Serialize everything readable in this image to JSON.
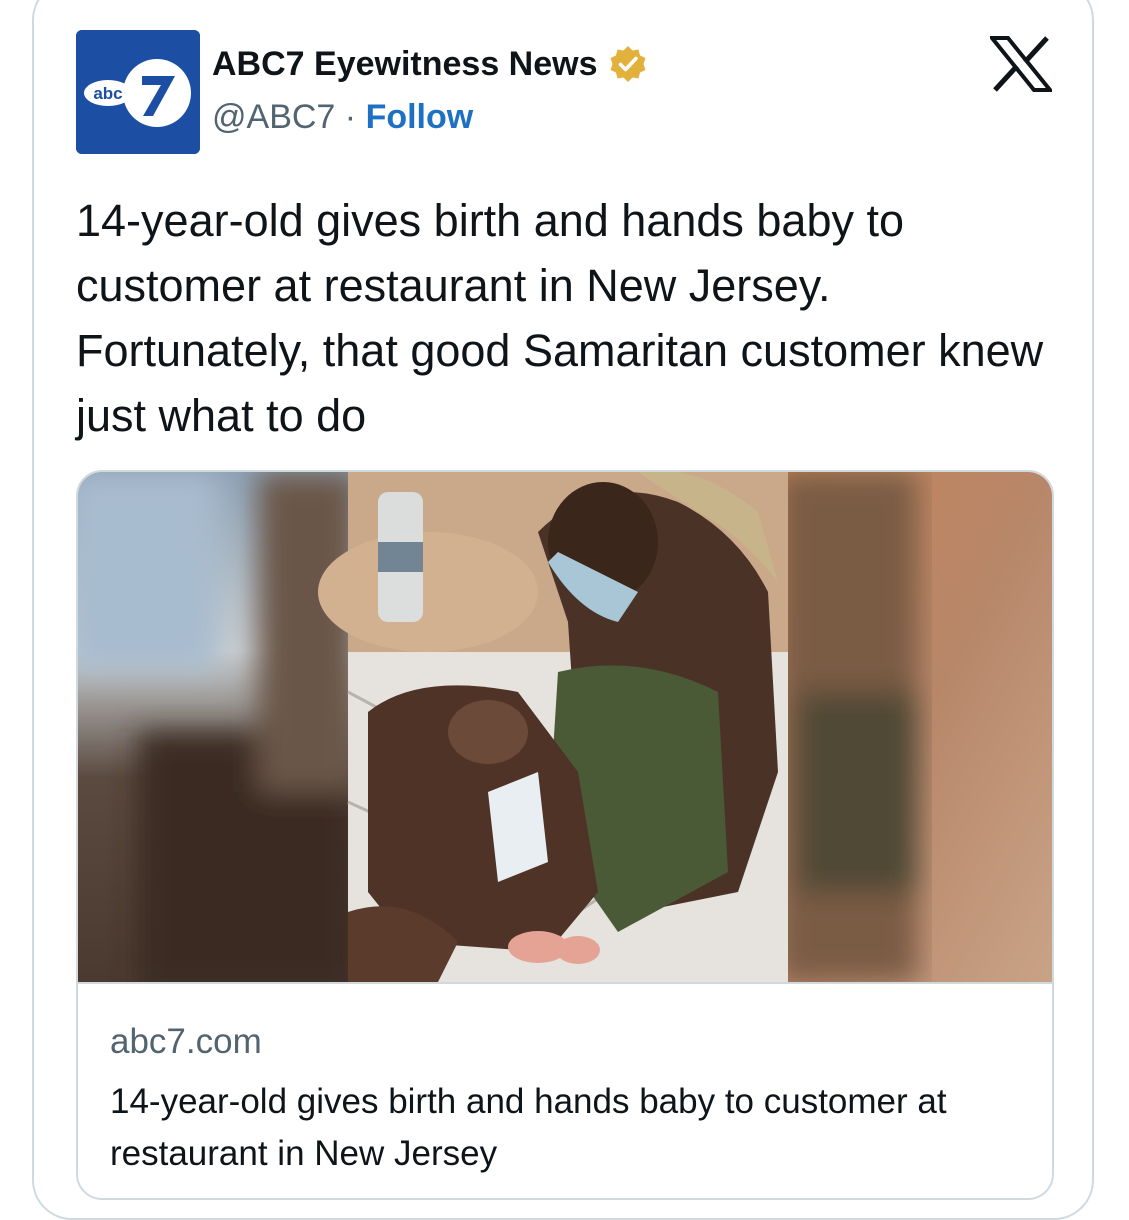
{
  "account": {
    "display_name": "ABC7 Eyewitness News",
    "handle": "@ABC7",
    "separator": "·",
    "follow_label": "Follow",
    "verified_icon": "gold-verified-badge-icon",
    "avatar_logo_text": "abc",
    "avatar_logo_number": "7"
  },
  "platform": {
    "logo_icon": "x-logo-icon"
  },
  "tweet": {
    "text": "14-year-old gives birth and hands baby to customer at restaurant in New Jersey. Fortunately, that good Samaritan customer knew just what to do"
  },
  "link_card": {
    "domain": "abc7.com",
    "title": "14-year-old gives birth and hands baby to customer at restaurant in New Jersey"
  },
  "colors": {
    "avatar_bg": "#1c4fa3",
    "follow": "#1d70c4",
    "verified": "#e2b13c",
    "text_primary": "#0f1419",
    "text_secondary": "#536471",
    "border": "#cfd9de"
  }
}
